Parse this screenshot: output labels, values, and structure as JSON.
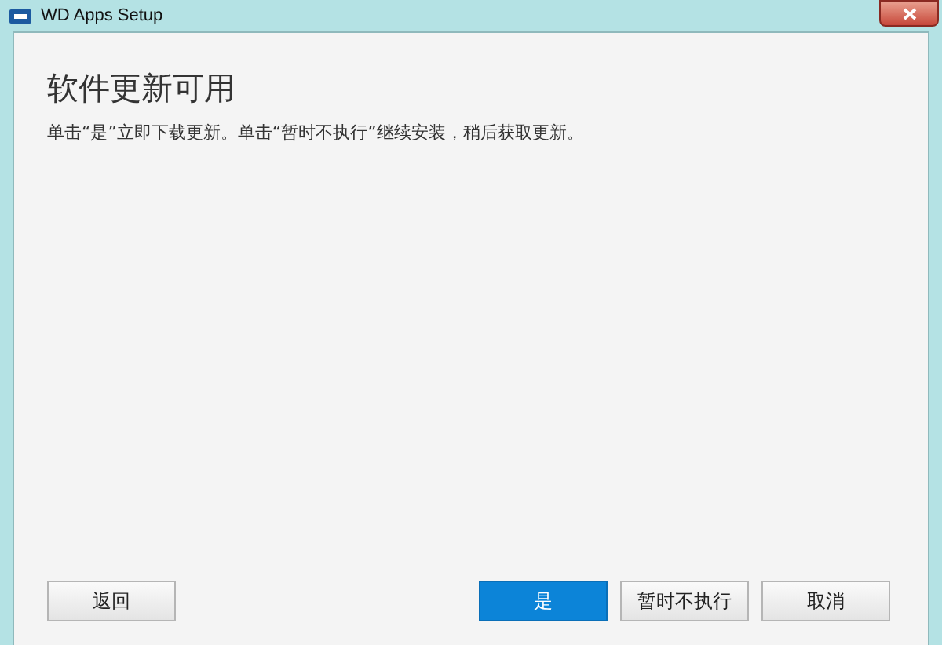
{
  "window": {
    "title": "WD Apps Setup"
  },
  "heading": "软件更新可用",
  "description": "单击“是”立即下载更新。单击“暂时不执行”继续安装，稍后获取更新。",
  "buttons": [
    {
      "label": "返回",
      "kind": "default"
    },
    {
      "label": "是",
      "kind": "primary"
    },
    {
      "label": "暂时不执行",
      "kind": "default"
    },
    {
      "label": "取消",
      "kind": "default"
    }
  ]
}
